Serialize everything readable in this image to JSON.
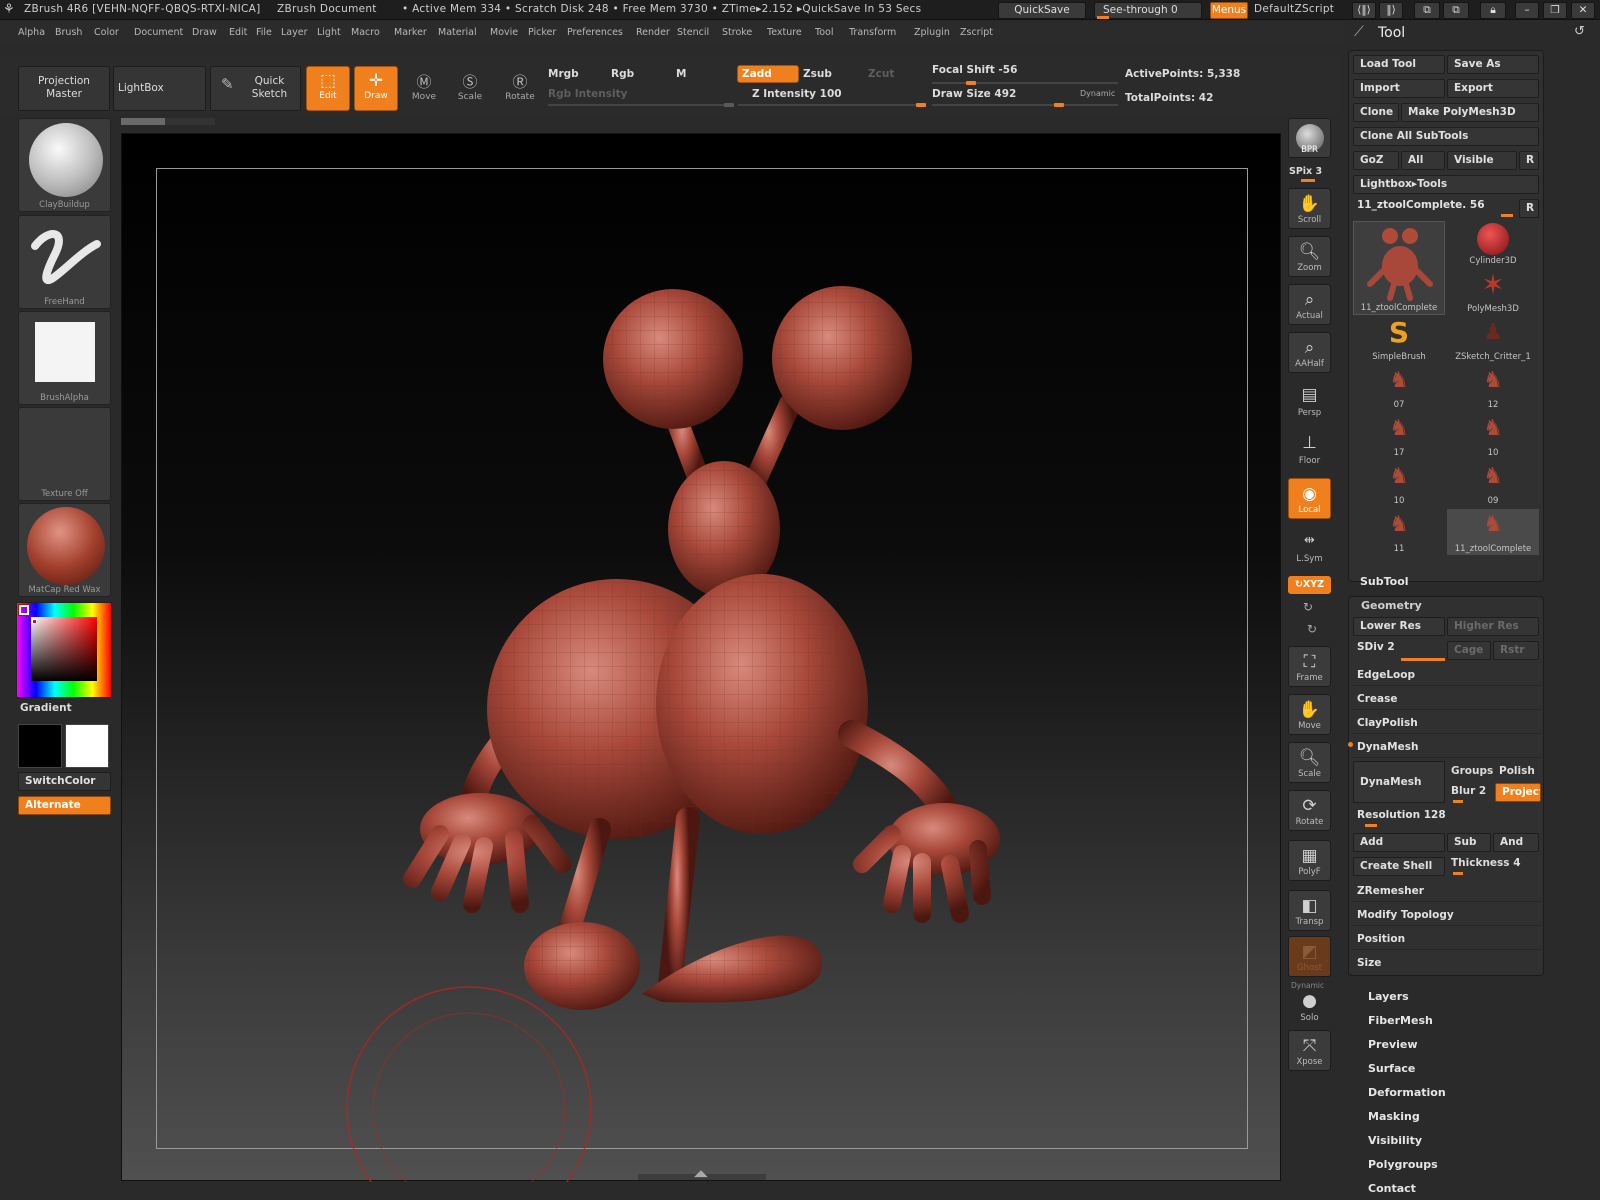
{
  "titlebar": {
    "app": "ZBrush 4R6 [VEHN-NQFF-QBQS-RTXI-NICA]",
    "doc": "ZBrush Document",
    "status": "• Active Mem 334 • Scratch Disk 248 • Free Mem 3730 • ZTime▸2.152 ▸QuickSave In 53 Secs",
    "quicksave": "QuickSave",
    "see_through": "See-through  0",
    "menus": "Menus",
    "script": "DefaultZScript"
  },
  "menu": [
    "Alpha",
    "Brush",
    "Color",
    "Document",
    "Draw",
    "Edit",
    "File",
    "Layer",
    "Light",
    "Macro",
    "Marker",
    "Material",
    "Movie",
    "Picker",
    "Preferences",
    "Render",
    "Stencil",
    "Stroke",
    "Texture",
    "Tool",
    "Transform",
    "Zplugin",
    "Zscript"
  ],
  "toolbar": {
    "projection_master": "Projection Master",
    "lightbox": "LightBox",
    "quick_sketch": "Quick Sketch",
    "edit": "Edit",
    "draw": "Draw",
    "move": "Move",
    "scale": "Scale",
    "rotate": "Rotate",
    "mrgb": "Mrgb",
    "rgb": "Rgb",
    "m": "M",
    "zadd": "Zadd",
    "zsub": "Zsub",
    "zcut": "Zcut",
    "rgb_intensity": "Rgb Intensity",
    "z_intensity": "Z Intensity 100",
    "focal_shift": "Focal Shift -56",
    "draw_size": "Draw Size 492",
    "dynamic": "Dynamic",
    "active_points": "ActivePoints: 5,338",
    "total_points": "TotalPoints: 42"
  },
  "left": {
    "brush": "ClayBuildup",
    "stroke": "FreeHand",
    "alpha": "BrushAlpha",
    "texture": "Texture Off",
    "material": "MatCap Red Wax",
    "gradient": "Gradient",
    "switchcolor": "SwitchColor",
    "alternate": "Alternate"
  },
  "shelf": {
    "bpr": "BPR",
    "spix": "SPix 3",
    "scroll": "Scroll",
    "zoom": "Zoom",
    "actual": "Actual",
    "aahalf": "AAHalf",
    "persp": "Persp",
    "floor": "Floor",
    "local": "Local",
    "lsym": "L.Sym",
    "xyz": "↻XYZ",
    "frame": "Frame",
    "move": "Move",
    "scale": "Scale",
    "rotate": "Rotate",
    "polyf": "PolyF",
    "transp": "Transp",
    "ghost": "Ghost",
    "dynamic": "Dynamic",
    "solo": "Solo",
    "xpose": "Xpose"
  },
  "tool": {
    "title": "Tool",
    "load": "Load Tool",
    "save_as": "Save As",
    "import": "Import",
    "export": "Export",
    "clone": "Clone",
    "make_polymesh": "Make PolyMesh3D",
    "clone_all": "Clone All SubTools",
    "goz": "GoZ",
    "all": "All",
    "visible": "Visible",
    "r": "R",
    "lightbox_tools": "Lightbox▸Tools",
    "current": "11_ztoolComplete. 56",
    "thumbs": [
      "11_ztoolComplete",
      "Cylinder3D",
      "PolyMesh3D",
      "SimpleBrush",
      "ZSketch_Critter_1",
      "07",
      "12",
      "17",
      "10",
      "10",
      "09",
      "11",
      "11_ztoolComplete"
    ],
    "subtool": "SubTool",
    "geometry": "Geometry",
    "lower_res": "Lower Res",
    "higher_res": "Higher Res",
    "sdiv": "SDiv 2",
    "cage": "Cage",
    "rstr": "Rstr",
    "edgeloop": "EdgeLoop",
    "crease": "Crease",
    "claypolish": "ClayPolish",
    "dynamesh_hdr": "DynaMesh",
    "dynamesh": "DynaMesh",
    "groups": "Groups",
    "polish": "Polish",
    "blur": "Blur 2",
    "project": "Project",
    "resolution": "Resolution 128",
    "add": "Add",
    "sub": "Sub",
    "and": "And",
    "create_shell": "Create Shell",
    "thickness": "Thickness 4",
    "zremesher": "ZRemesher",
    "modify_topology": "Modify Topology",
    "position": "Position",
    "size": "Size",
    "sections": [
      "Layers",
      "FiberMesh",
      "Preview",
      "Surface",
      "Deformation",
      "Masking",
      "Visibility",
      "Polygroups",
      "Contact"
    ]
  },
  "colors": {
    "accent": "#f0801e",
    "bg": "#2a2a2a",
    "model": "#a8483a"
  }
}
